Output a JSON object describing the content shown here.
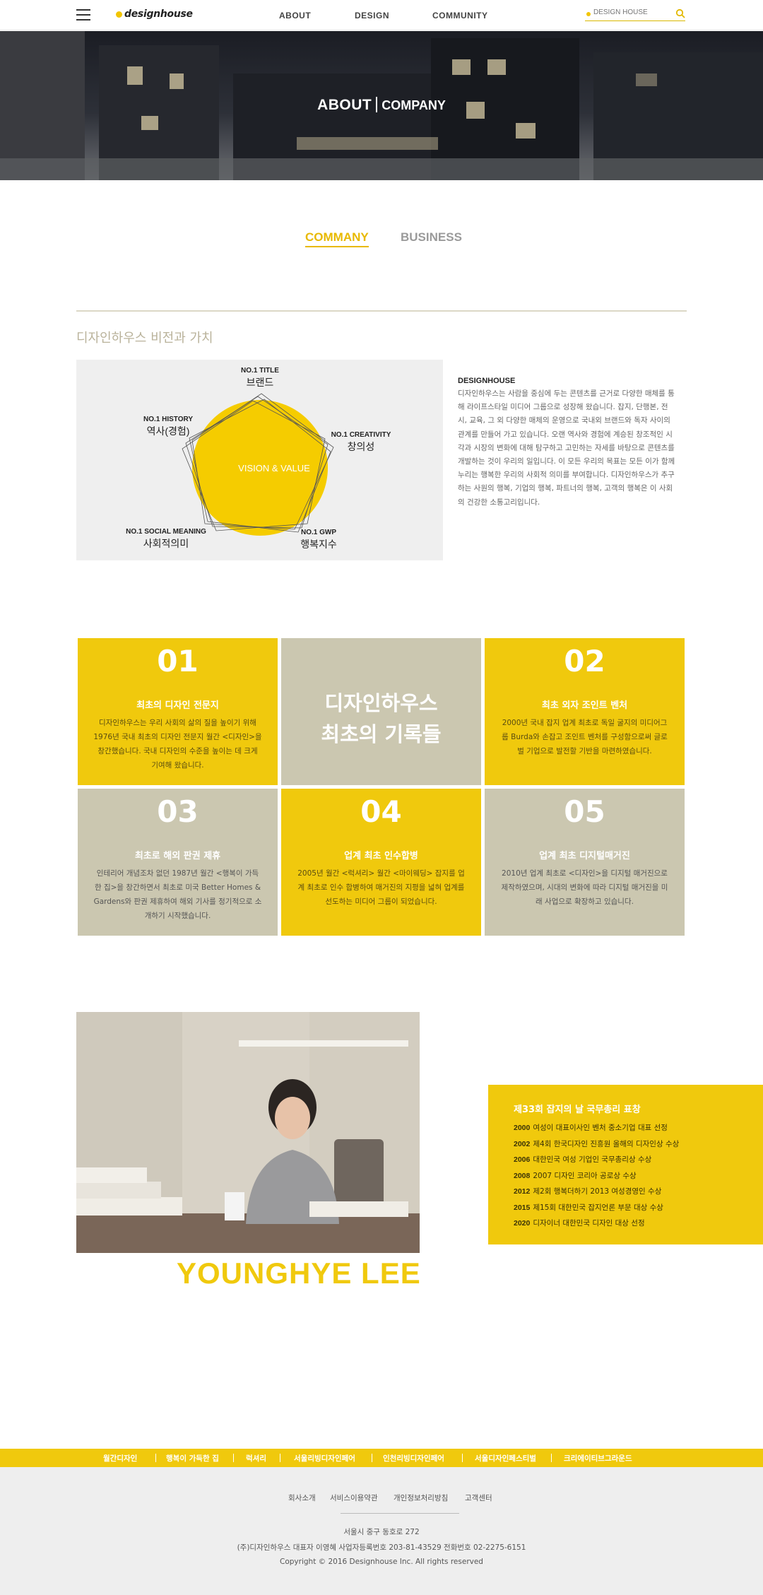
{
  "header": {
    "logo_text": "designhouse",
    "nav": [
      "ABOUT",
      "DESIGN",
      "COMMUNITY"
    ],
    "search_placeholder": "DESIGN HOUSE"
  },
  "hero": {
    "title_main": "ABOUT",
    "title_sub": "COMPANY"
  },
  "tabs": [
    {
      "label": "COMMANY",
      "active": true
    },
    {
      "label": "BUSINESS",
      "active": false
    }
  ],
  "vision": {
    "heading": "디자인하우스 비전과 가치",
    "center": "VISION & VALUE",
    "points": [
      {
        "en": "NO.1 TITLE",
        "ko": "브랜드"
      },
      {
        "en": "NO.1 CREATIVITY",
        "ko": "창의성"
      },
      {
        "en": "NO.1 GWP",
        "ko": "행복지수"
      },
      {
        "en": "NO.1 SOCIAL MEANING",
        "ko": "사회적의미"
      },
      {
        "en": "NO.1 HISTORY",
        "ko": "역사(경험)"
      }
    ],
    "desc_title": "DESIGNHOUSE",
    "desc_text": "디자인하우스는 사람을 중심에 두는 콘텐츠를 근거로 다양한 매체를 통해 라이프스타일 미디어 그룹으로 성장해 왔습니다. 잡지, 단행본, 전시, 교육, 그 외 다양한 매체의 운영으로 국내외 브랜드와 독자 사이의 관계를 만들어 가고 있습니다. 오랜 역사와 경험에 계승된 창조적인 시각과 시장의 변화에 대해 탐구하고 고민하는 자세를 바탕으로 콘텐츠를 개발하는 것이 우리의 일입니다. 이 모든 우리의 목표는 모든 이가 함께 누리는 행복한 우리의 사회적 의미를 부여합니다. 디자인하우스가 추구하는 사원의 행복, 기업의 행복, 파트너의 행복, 고객의 행복은 이 사회의 건강한 소통고리입니다."
  },
  "records": {
    "title_line1": "디자인하우스",
    "title_line2": "최초의 기록들",
    "items": [
      {
        "num": "01",
        "title": "최초의 디자인 전문지",
        "text": "디자인하우스는 우리 사회의 삶의 질을 높이기 위해 1976년 국내 최초의 디자인 전문지 월간 <디자인>을 창간했습니다. 국내 디자인의 수준을 높이는 데 크게 기여해 왔습니다."
      },
      {
        "num": "02",
        "title": "최초 외자 조인트 벤처",
        "text": "2000년 국내 잡지 업계 최초로 독일 굴지의 미디어그룹 Burda와 손잡고 조인트 벤처를 구성함으로써 글로벌 기업으로 발전할 기반을 마련하였습니다."
      },
      {
        "num": "03",
        "title": "최초로 해외 판권 제휴",
        "text": "인테리어 개념조차 없던 1987년 월간 <행복이 가득한 집>을 창간하면서 최초로 미국 Better Homes & Gardens와 판권 제휴하여 해외 기사를 정기적으로 소개하기 시작했습니다."
      },
      {
        "num": "04",
        "title": "업계 최초 인수합병",
        "text": "2005년 월간 <럭셔리> 월간 <마이웨딩> 잡지를 업계 최초로 인수 합병하여 매거진의 지평을 넓혀 업계를 선도하는 미디어 그룹이 되었습니다."
      },
      {
        "num": "05",
        "title": "업계 최초 디지털매거진",
        "text": "2010년 업계 최초로 <디자인>을 디지털 매거진으로 제작하였으며, 시대의 변화에 따라 디지털 매거진을 미래 사업으로 확장하고 있습니다."
      }
    ]
  },
  "profile": {
    "name": "YOUNGHYE LEE",
    "award_title": "제33회 잡지의 날 국무총리 표창",
    "awards": [
      {
        "year": "2000",
        "text": "여성이 대표이사인 벤처 중소기업 대표 선정"
      },
      {
        "year": "2002",
        "text": "제4회 한국디자인 진흥원 올해의 디자인상 수상"
      },
      {
        "year": "2006",
        "text": "대한민국 여성 기업인 국무총리상 수상"
      },
      {
        "year": "2008",
        "text": "2007 디자인 코리아 공로상 수상"
      },
      {
        "year": "2012",
        "text": "제2회 행복더하기 2013 여성경영인 수상"
      },
      {
        "year": "2015",
        "text": "제15회 대한민국 잡지언론 부문 대상 수상"
      },
      {
        "year": "2020",
        "text": "디자이너 대한민국 디자인 대상 선정"
      }
    ]
  },
  "footer": {
    "brands": [
      "월간디자인",
      "행복이 가득한 집",
      "럭셔리",
      "서울리빙디자인페어",
      "인천리빙디자인페어",
      "서울디자인페스티벌",
      "크리에이티브그라운드"
    ],
    "links": [
      "회사소개",
      "서비스이용약관",
      "개인정보처리방침",
      "고객센터"
    ],
    "address": "서울시 중구 동호로 272",
    "company": "(주)디자인하우스 대표자 이영혜 사업자등록번호 203-81-43529 전화번호 02-2275-6151",
    "copyright": "Copyright © 2016 Designhouse Inc. All rights reserved"
  },
  "colors": {
    "accent": "#f0c90d",
    "panel_gray": "#cbc7b0",
    "heading_beige": "#b9b29a"
  }
}
